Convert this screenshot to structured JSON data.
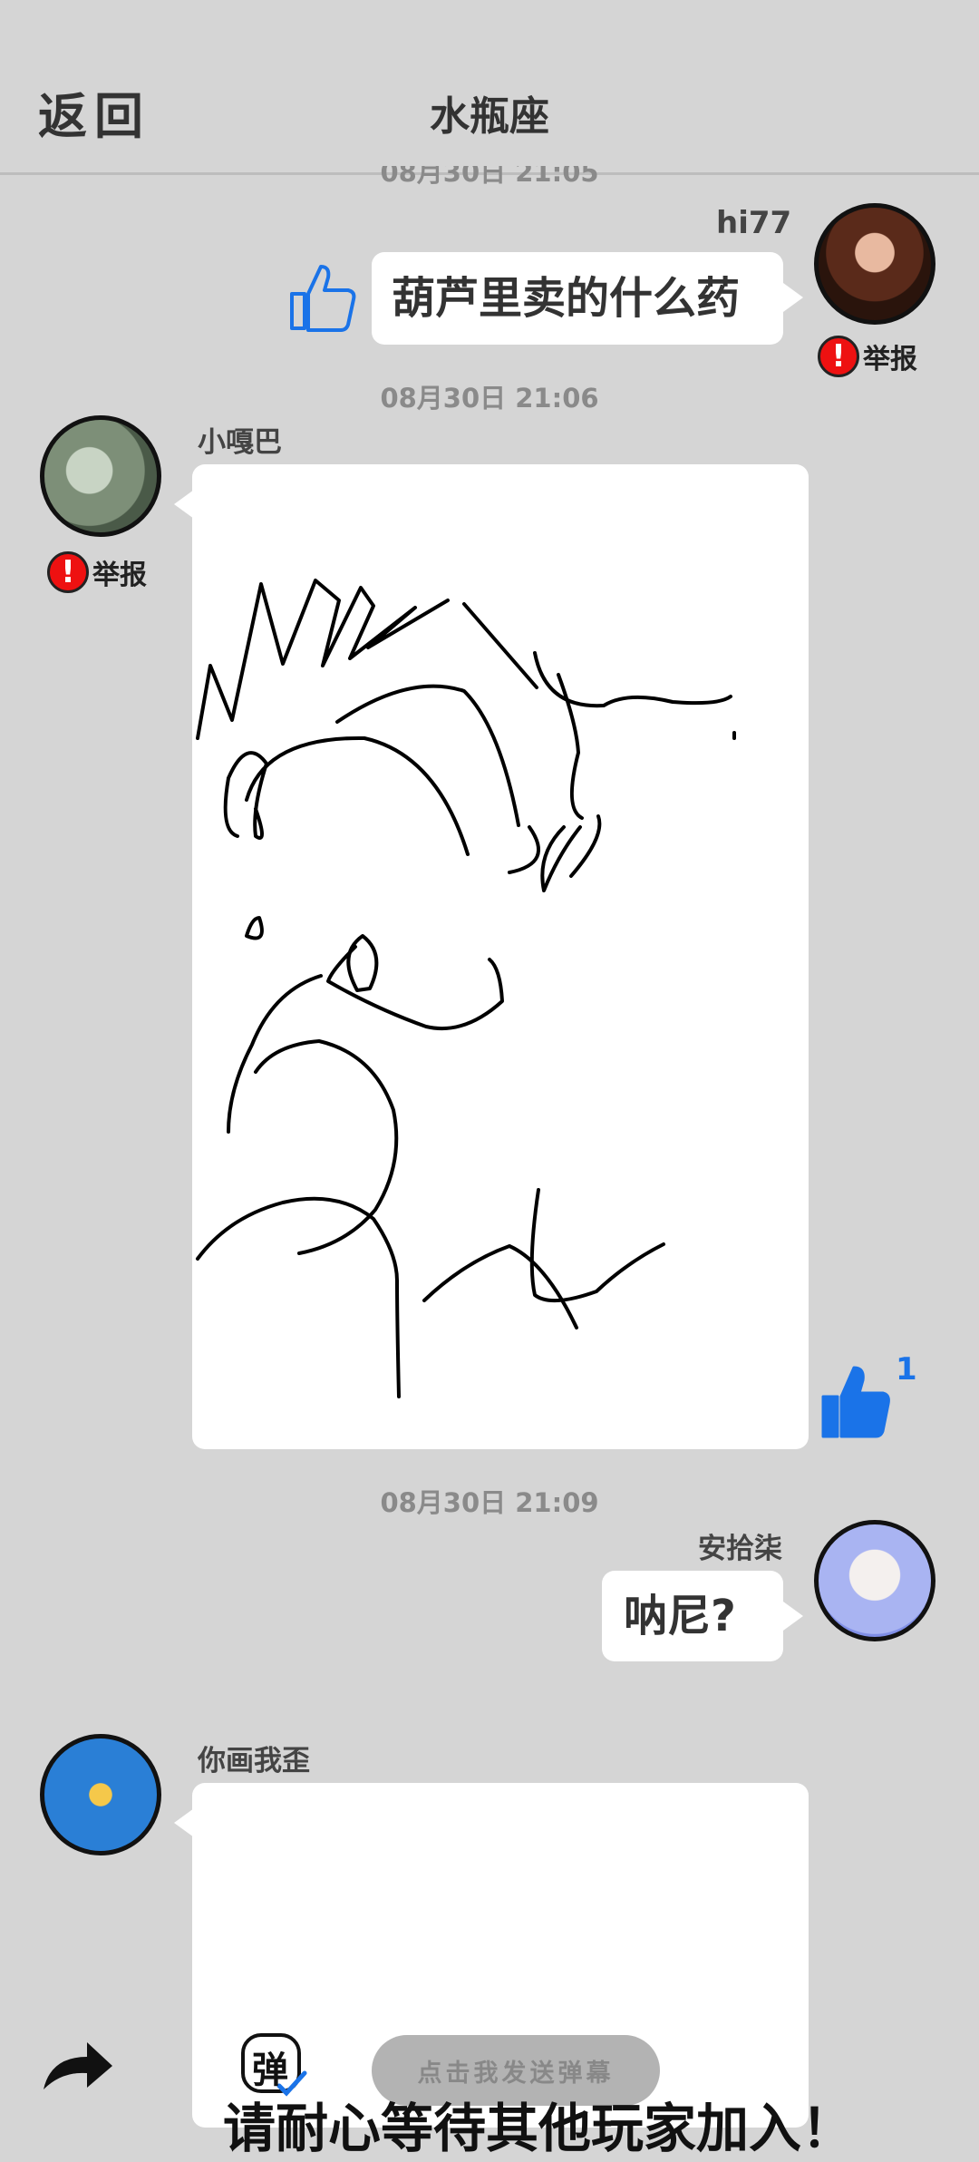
{
  "header": {
    "back_label": "返回",
    "title": "水瓶座"
  },
  "messages": {
    "partial_timestamp": "08月30日  21:05",
    "m1": {
      "user": "hi77",
      "text": "葫芦里卖的什么药",
      "report": "举报"
    },
    "ts2": "08月30日  21:06",
    "m2": {
      "user": "小嘎巴",
      "report": "举报",
      "like_count": "1"
    },
    "ts3": "08月30日  21:09",
    "m3": {
      "user": "安拾柒",
      "text": "呐尼?"
    },
    "m4": {
      "user": "你画我歪"
    }
  },
  "footer": {
    "danmu_label": "点击我发送弹幕",
    "wait_text": "请耐心等待其他玩家加入！",
    "danmu_icon_char": "弹"
  },
  "colors": {
    "background": "#d5d5d5",
    "like_blue": "#1a73e8",
    "report_red": "#e11111"
  },
  "icons": [
    "share-icon",
    "thumbs-up-icon",
    "exclamation-icon",
    "danmu-icon"
  ]
}
